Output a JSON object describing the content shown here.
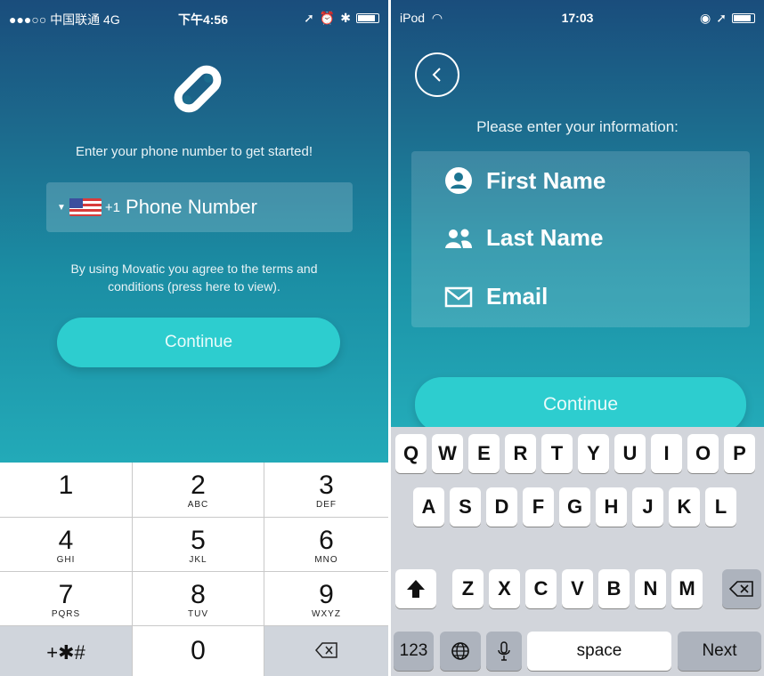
{
  "left": {
    "status": {
      "left": "●●●○○ 中国联通 4G",
      "time": "下午4:56"
    },
    "headline": "Enter your phone number to get started!",
    "phone": {
      "country_code": "+1",
      "placeholder": "Phone Number"
    },
    "terms": "By using Movatic you agree to the terms and conditions (press here to view).",
    "continue_label": "Continue",
    "numpad": [
      {
        "digit": "1",
        "letters": ""
      },
      {
        "digit": "2",
        "letters": "ABC"
      },
      {
        "digit": "3",
        "letters": "DEF"
      },
      {
        "digit": "4",
        "letters": "GHI"
      },
      {
        "digit": "5",
        "letters": "JKL"
      },
      {
        "digit": "6",
        "letters": "MNO"
      },
      {
        "digit": "7",
        "letters": "PQRS"
      },
      {
        "digit": "8",
        "letters": "TUV"
      },
      {
        "digit": "9",
        "letters": "WXYZ"
      },
      {
        "digit": "+✱#",
        "letters": ""
      },
      {
        "digit": "0",
        "letters": ""
      }
    ]
  },
  "right": {
    "status": {
      "left": "iPod",
      "time": "17:03"
    },
    "prompt": "Please enter your information:",
    "fields": {
      "first_name": "First Name",
      "last_name": "Last Name",
      "email": "Email"
    },
    "continue_label": "Continue",
    "keyboard": {
      "row1": [
        "Q",
        "W",
        "E",
        "R",
        "T",
        "Y",
        "U",
        "I",
        "O",
        "P"
      ],
      "row2": [
        "A",
        "S",
        "D",
        "F",
        "G",
        "H",
        "J",
        "K",
        "L"
      ],
      "row3": [
        "Z",
        "X",
        "C",
        "V",
        "B",
        "N",
        "M"
      ],
      "numbers_label": "123",
      "space_label": "space",
      "next_label": "Next"
    }
  },
  "colors": {
    "accent": "#2dcdcf",
    "gradient_top": "#1a4d7c",
    "gradient_bottom": "#23aab8"
  }
}
